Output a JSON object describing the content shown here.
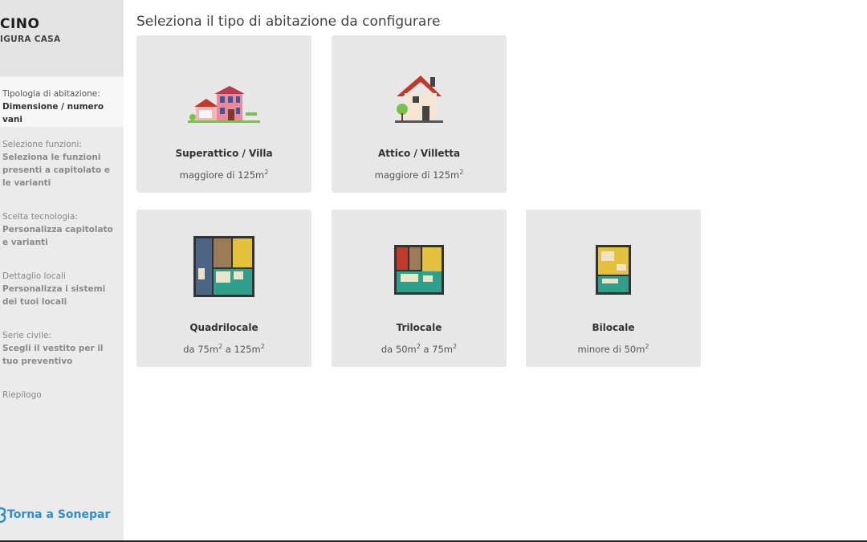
{
  "brand": {
    "logo_text": "CINO",
    "app_name": "IGURA CASA"
  },
  "steps": [
    {
      "label": "Tipologia di abitazione:",
      "desc": "Dimensione / numero vani"
    },
    {
      "label": "Selezione funzioni:",
      "desc": "Seleziona le funzioni presenti a capitolato e le varianti"
    },
    {
      "label": "Scelta tecnologia:",
      "desc": "Personalizza capitolato e varianti"
    },
    {
      "label": "Dettaglio locali",
      "desc": "Personalizza i sistemi dei tuoi locali"
    },
    {
      "label": "Serie civile:",
      "desc": "Scegli il vestito per il tuo preventivo"
    },
    {
      "label": "Riepilogo",
      "desc": ""
    }
  ],
  "back_link": "Torna a Sonepar",
  "main": {
    "title": "Seleziona il tipo di abitazione da configurare",
    "cards": [
      {
        "name": "Superattico / Villa",
        "size_text": "maggiore di 125m",
        "sup": "2",
        "icon": "villa-icon"
      },
      {
        "name": "Attico / Villetta",
        "size_text": "maggiore di 125m",
        "sup": "2",
        "icon": "house-icon"
      },
      {
        "name": "Quadrilocale",
        "size_a": "da 75m",
        "sup_a": "2",
        "size_b": " a 125m",
        "sup_b": "2",
        "icon": "floorplan-4-icon"
      },
      {
        "name": "Trilocale",
        "size_a": "da 50m",
        "sup_a": "2",
        "size_b": " a 75m",
        "sup_b": "2",
        "icon": "floorplan-3-icon"
      },
      {
        "name": "Bilocale",
        "size_text": "minore di 50m",
        "sup": "2",
        "icon": "floorplan-2-icon"
      }
    ]
  },
  "colors": {
    "accent": "#2f8fd0",
    "sidebar": "#ebebeb",
    "card": "#e7e7e7"
  }
}
